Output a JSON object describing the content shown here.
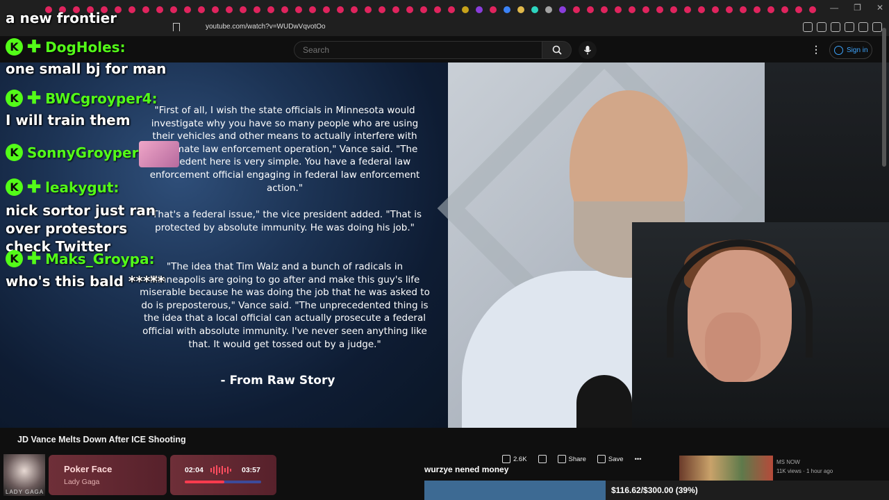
{
  "browser": {
    "url": "youtube.com/watch?v=WUDwVqvotOo",
    "tab_colors": [
      "#e0245e",
      "#e0245e",
      "#e0245e",
      "#e0245e",
      "#e0245e",
      "#e0245e",
      "#e0245e",
      "#e0245e",
      "#e0245e",
      "#e0245e",
      "#e0245e",
      "#e0245e",
      "#e0245e",
      "#e0245e",
      "#e0245e",
      "#e0245e",
      "#e0245e",
      "#e0245e",
      "#e0245e",
      "#e0245e",
      "#e0245e",
      "#e0245e",
      "#e0245e",
      "#e0245e",
      "#e0245e",
      "#e0245e",
      "#e0245e",
      "#e0245e",
      "#e0245e",
      "#e0245e",
      "#c7a21a",
      "#8a3ddb",
      "#e0245e",
      "#3b82f6",
      "#e0b84b",
      "#2dd4bf",
      "#a3a3a3",
      "#8a3ddb",
      "#e0245e",
      "#e0245e",
      "#e0245e",
      "#e0245e",
      "#e0245e",
      "#e0245e",
      "#e0245e",
      "#e0245e",
      "#e0245e",
      "#e0245e",
      "#e0245e",
      "#e0245e",
      "#e0245e",
      "#e0245e",
      "#e0245e",
      "#e0245e",
      "#e0245e",
      "#e0245e"
    ]
  },
  "youtube": {
    "search_placeholder": "Search",
    "signin_label": "Sign in",
    "video_title": "JD Vance Melts Down After ICE Shooting",
    "likes": "2.6K",
    "share_label": "Share",
    "save_label": "Save",
    "rec_channel": "MS NOW",
    "rec_meta": "11K views · 1 hour ago"
  },
  "article": {
    "p1": "\"First of all, I wish the state officials in Minnesota would investigate why you have so many people who are using their vehicles and other means to actually interfere with legitimate law enforcement operation,\" Vance said. \"The precedent here is very simple. You have a federal law enforcement official engaging in federal law enforcement action.\"",
    "p2": "\"That's a federal issue,\" the vice president added. \"That is protected by absolute immunity. He was doing his job.\"",
    "p3": "\"The idea that Tim Walz and a bunch of radicals in Minneapolis are going to go after and make this guy's life miserable because he was doing the job that he was asked to do is preposterous,\" Vance said. \"The unprecedented thing is the idea that a local official can actually prosecute a federal official with absolute immunity. I've never seen anything like that. It would get tossed out by a judge.\"",
    "credit": "- From Raw Story"
  },
  "chat": {
    "top_message": "a new frontier",
    "badge_letter": "K",
    "messages": [
      {
        "user": "DogHoles:",
        "text": "one small bj for man"
      },
      {
        "user": "BWCgroyper4:",
        "text": "I will train them"
      },
      {
        "user": "SonnyGroyper:",
        "text": ""
      },
      {
        "user": "leakygut:",
        "text": "nick sortor just ran over protestors check Twitter"
      },
      {
        "user": "Maks_Groypa:",
        "text": "who's this bald *****"
      }
    ],
    "colors": {
      "username": "#53fc18",
      "text": "#ffffff"
    }
  },
  "music": {
    "title": "Poker Face",
    "artist": "Lady Gaga",
    "album_text": "LADY GAGA",
    "current_time": "02:04",
    "total_time": "03:57",
    "progress_fraction": 0.52
  },
  "goal": {
    "label": "wurzye nened money",
    "text": "$116.62/$300.00 (39%)",
    "fraction": 0.39
  }
}
